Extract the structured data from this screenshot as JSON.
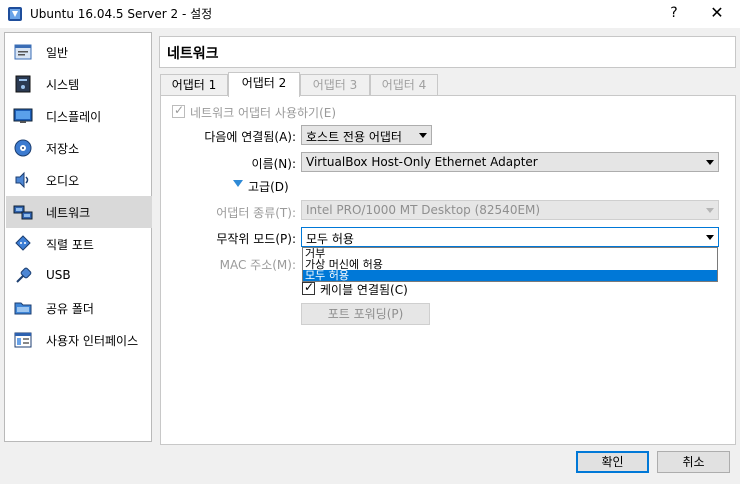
{
  "window": {
    "title": "Ubuntu 16.04.5 Server 2 - 설정",
    "help": "?",
    "close": "✕"
  },
  "sidebar": {
    "items": [
      {
        "label": "일반",
        "icon": "general-icon"
      },
      {
        "label": "시스템",
        "icon": "system-icon"
      },
      {
        "label": "디스플레이",
        "icon": "display-icon"
      },
      {
        "label": "저장소",
        "icon": "storage-icon"
      },
      {
        "label": "오디오",
        "icon": "audio-icon"
      },
      {
        "label": "네트워크",
        "icon": "network-icon"
      },
      {
        "label": "직렬 포트",
        "icon": "serial-port-icon"
      },
      {
        "label": "USB",
        "icon": "usb-icon"
      },
      {
        "label": "공유 폴더",
        "icon": "shared-folder-icon"
      },
      {
        "label": "사용자 인터페이스",
        "icon": "user-interface-icon"
      }
    ],
    "selected_index": 5
  },
  "page_title": "네트워크",
  "tabs": [
    {
      "label": "어댑터 1"
    },
    {
      "label": "어댑터 2"
    },
    {
      "label": "어댑터 3"
    },
    {
      "label": "어댑터 4"
    }
  ],
  "form": {
    "enable_adapter": "네트워크 어댑터 사용하기(E)",
    "attached_to": {
      "label": "다음에 연결됨(A):",
      "value": "호스트 전용 어댑터"
    },
    "name": {
      "label": "이름(N):",
      "value": "VirtualBox Host-Only Ethernet Adapter"
    },
    "advanced": "고급(D)",
    "adapter_type": {
      "label": "어댑터 종류(T):",
      "value": "Intel PRO/1000 MT Desktop (82540EM)"
    },
    "promiscuous_mode": {
      "label": "무작위 모드(P):",
      "value": "모두 허용",
      "options": [
        "거부",
        "가상 머신에 허용",
        "모두 허용"
      ],
      "selected_option": 2
    },
    "mac_address": {
      "label": "MAC 주소(M):"
    },
    "cable_connected": "케이블 연결됨(C)",
    "port_forwarding": "포트 포워딩(P)"
  },
  "buttons": {
    "ok": "확인",
    "cancel": "취소"
  }
}
